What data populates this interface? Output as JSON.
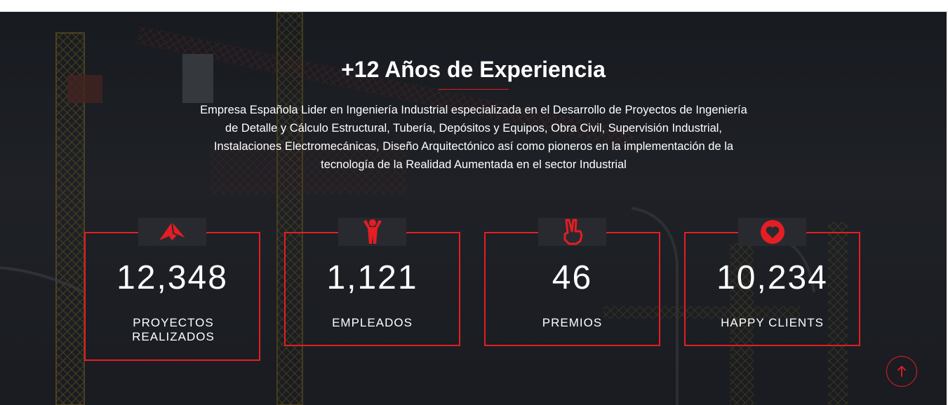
{
  "section": {
    "title": "+12 Años de Experiencia",
    "description": "Empresa Española Lider en Ingeniería Industrial especializada en el Desarrollo de Proyectos de Ingeniería de Detalle y Cálculo Estructural, Tubería, Depósitos y Equipos, Obra Civil, Supervisión Industrial, Instalaciones Electromecánicas, Diseño Arquitectónico así como pioneros en la implementación de la tecnología de la Realidad Aumentada en el sector Industrial"
  },
  "stats": [
    {
      "icon": "paper-plane-icon",
      "value": "12,348",
      "label": "PROYECTOS REALIZADOS"
    },
    {
      "icon": "person-cheering-icon",
      "value": "1,121",
      "label": "EMPLEADOS"
    },
    {
      "icon": "peace-hand-icon",
      "value": "46",
      "label": "PREMIOS"
    },
    {
      "icon": "heart-circle-icon",
      "value": "10,234",
      "label": "HAPPY CLIENTS"
    }
  ],
  "scroll_top_icon": "arrow-up-icon",
  "colors": {
    "accent": "#e31e24",
    "background": "#25272c",
    "text": "#ffffff"
  }
}
